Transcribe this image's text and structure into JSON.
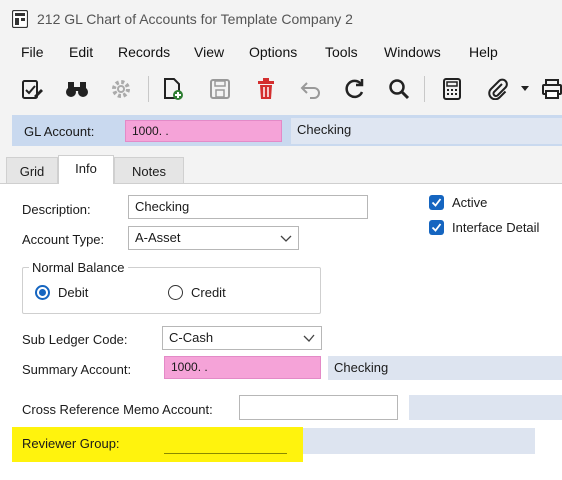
{
  "window": {
    "title": "212 GL Chart of Accounts for Template Company 2"
  },
  "menu": [
    "File",
    "Edit",
    "Records",
    "View",
    "Options",
    "Tools",
    "Windows",
    "Help"
  ],
  "toolbar": {
    "icons": [
      "edit-check-icon",
      "binoculars-icon",
      "gear-icon",
      "new-document-icon",
      "save-icon",
      "delete-icon",
      "undo-icon",
      "refresh-icon",
      "search-icon",
      "calculator-icon",
      "attachment-icon",
      "dropdown-arrow-icon",
      "print-icon"
    ]
  },
  "header": {
    "gl_account_label": "GL Account:",
    "gl_account_value": "1000.  .",
    "gl_account_desc": "Checking"
  },
  "tabs": [
    "Grid",
    "Info",
    "Notes"
  ],
  "active_tab": "Info",
  "form": {
    "description_label": "Description:",
    "description_value": "Checking",
    "account_type_label": "Account Type:",
    "account_type_value": "A-Asset",
    "active_label": "Active",
    "active_checked": true,
    "interface_detail_label": "Interface Detail",
    "interface_detail_checked": true,
    "normal_balance_label": "Normal Balance",
    "debit_label": "Debit",
    "credit_label": "Credit",
    "normal_balance_selected": "Debit",
    "sub_ledger_label": "Sub Ledger Code:",
    "sub_ledger_value": "C-Cash",
    "summary_account_label": "Summary Account:",
    "summary_account_value": "1000.  .",
    "summary_account_desc": "Checking",
    "cross_ref_label": "Cross Reference Memo Account:",
    "cross_ref_value": "",
    "reviewer_group_label": "Reviewer Group:",
    "reviewer_group_value": ""
  },
  "colors": {
    "accent_blue": "#1565c0",
    "pink_field": "#f5a3d8",
    "header_blue": "#c9d9ef",
    "highlight_yellow": "#fff200",
    "delete_red": "#d32f2f"
  }
}
